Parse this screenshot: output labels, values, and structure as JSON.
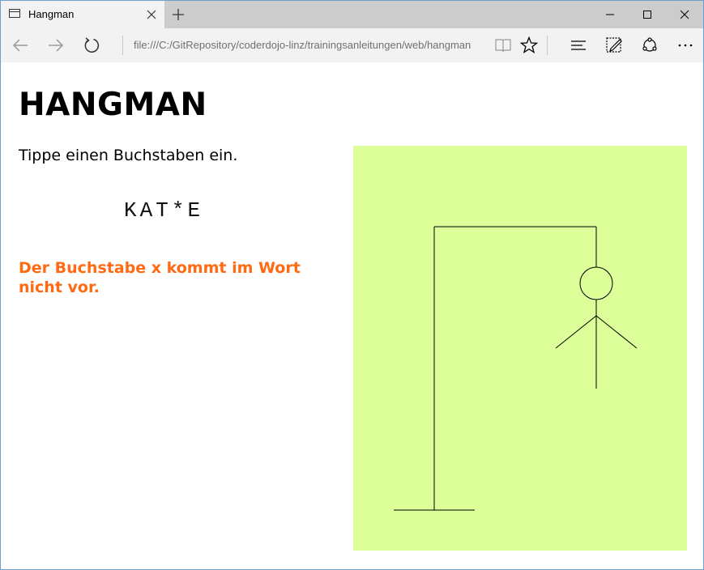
{
  "browser": {
    "tab_title": "Hangman",
    "url": "file:///C:/GitRepository/coderdojo-linz/trainingsanleitungen/web/hangman",
    "icons": [
      "page-icon",
      "close-icon",
      "plus-icon",
      "minimize-icon",
      "maximize-icon",
      "window-close-icon",
      "back-arrow-icon",
      "forward-arrow-icon",
      "refresh-icon",
      "reading-view-icon",
      "star-icon",
      "hub-icon",
      "web-note-icon",
      "share-icon",
      "more-icon"
    ]
  },
  "page": {
    "title": "HANGMAN",
    "instruction": "Tippe einen Buchstaben ein.",
    "word": "KAT*E",
    "message": "Der Buchstabe x kommt im Wort nicht vor.",
    "colors": {
      "message": "#ff6a13",
      "canvas_background": "#dcff99"
    },
    "hangman_parts_shown": [
      "base",
      "pole",
      "beam",
      "rope",
      "head",
      "body",
      "left-arm",
      "right-arm"
    ]
  }
}
